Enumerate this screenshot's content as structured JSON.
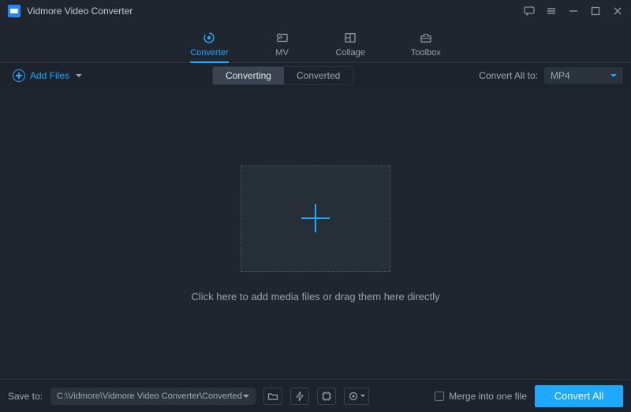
{
  "title": "Vidmore Video Converter",
  "tabs": {
    "converter": "Converter",
    "mv": "MV",
    "collage": "Collage",
    "toolbox": "Toolbox"
  },
  "toolbar": {
    "add_files": "Add Files",
    "seg_converting": "Converting",
    "seg_converted": "Converted",
    "convert_all_to": "Convert All to:",
    "format_selected": "MP4"
  },
  "main": {
    "hint": "Click here to add media files or drag them here directly"
  },
  "bottom": {
    "save_to_label": "Save to:",
    "save_path": "C:\\Vidmore\\Vidmore Video Converter\\Converted",
    "merge_label": "Merge into one file",
    "convert_all_button": "Convert All"
  }
}
